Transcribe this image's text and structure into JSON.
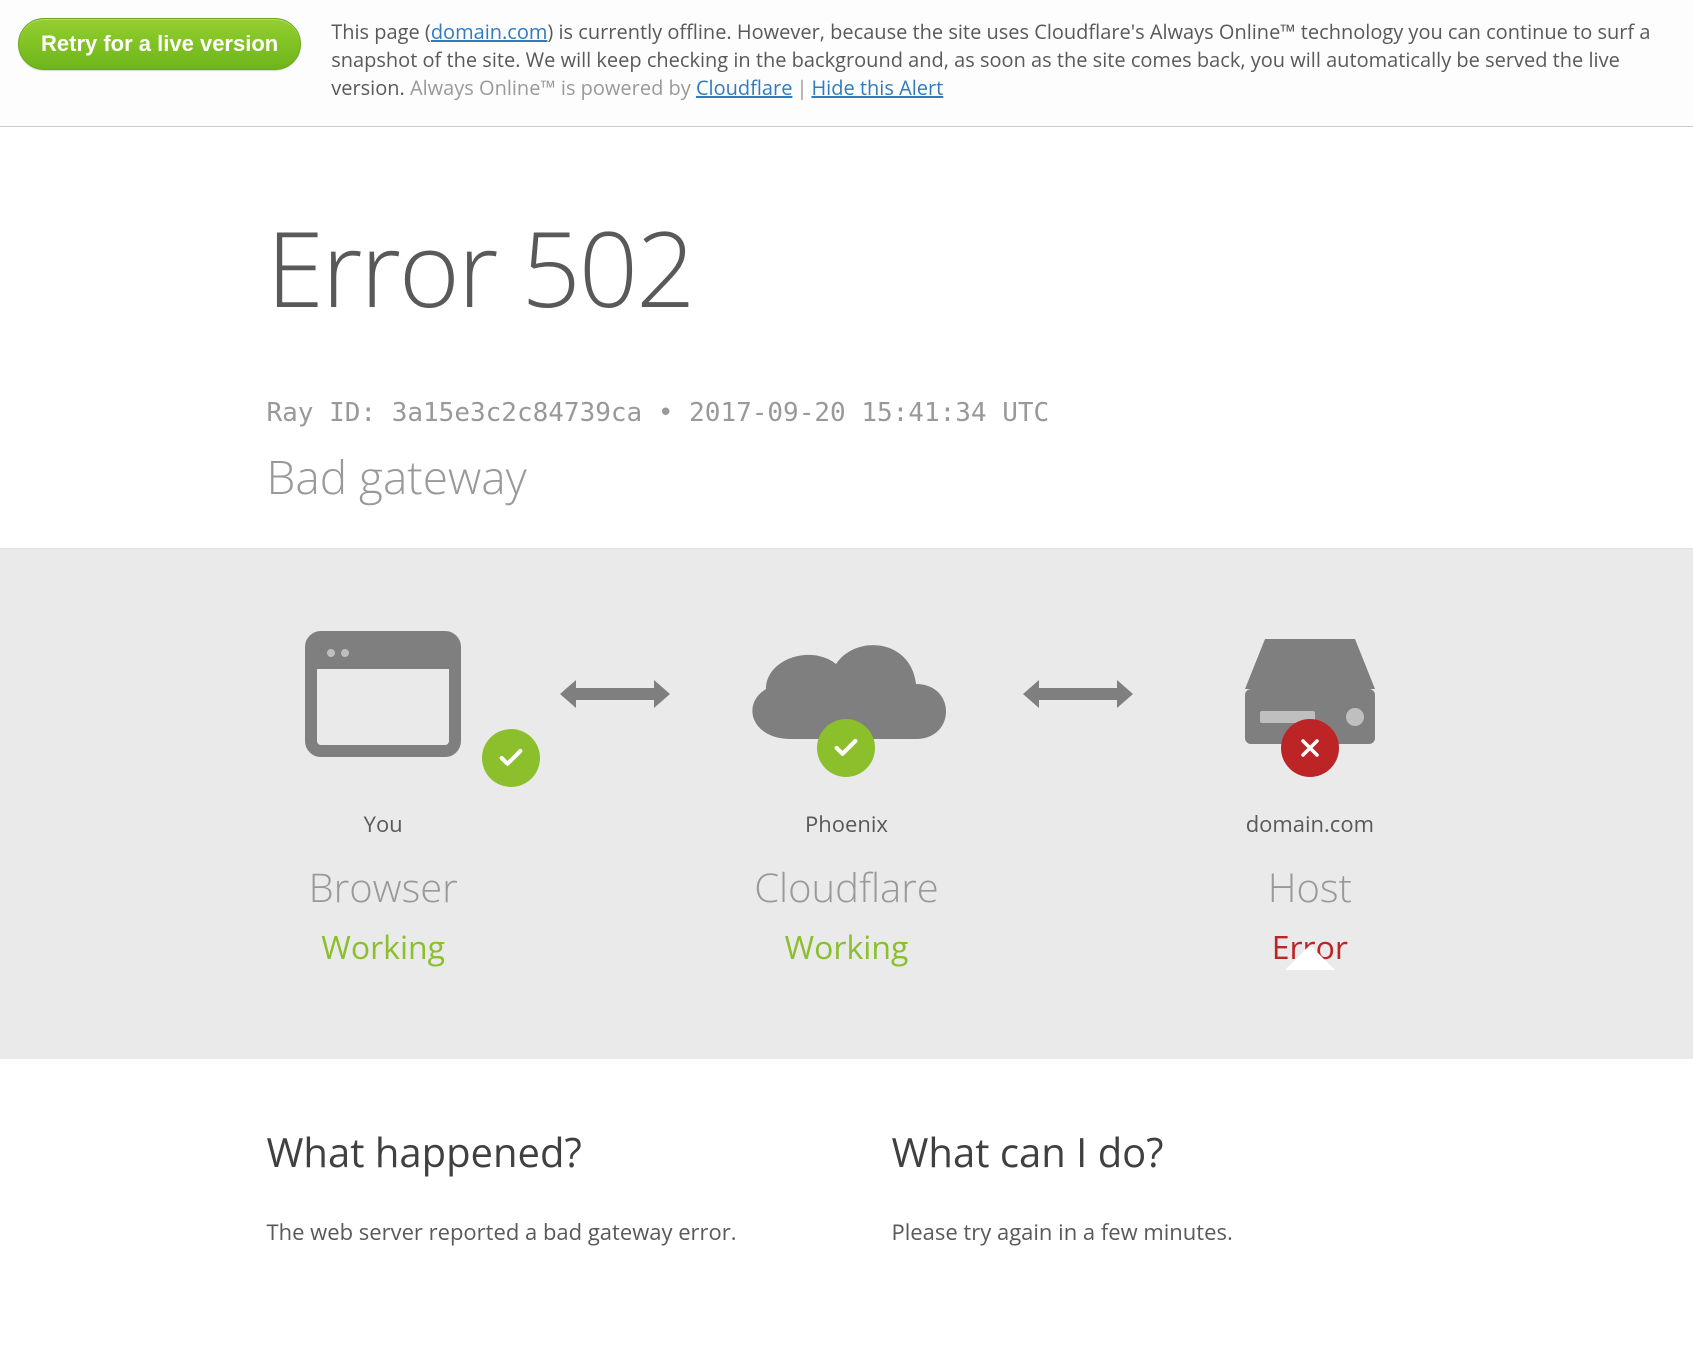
{
  "alert": {
    "retry_button": "Retry for a live version",
    "text1": "This page (",
    "domain_link": "domain.com",
    "text2": ") is currently offline. However, because the site uses Cloudflare's Always Online™ technology you can continue to surf a snapshot of the site. We will keep checking in the background and, as soon as the site comes back, you will automatically be served the live version. ",
    "powered_pre": "Always Online™ is powered by ",
    "cloudflare_link": "Cloudflare",
    "hide_link": "Hide this Alert"
  },
  "error": {
    "title": "Error 502",
    "ray": "Ray ID: 3a15e3c2c84739ca • 2017-09-20 15:41:34 UTC",
    "subtitle": "Bad gateway"
  },
  "nodes": {
    "you": {
      "label": "You",
      "title": "Browser",
      "status": "Working"
    },
    "cf": {
      "label": "Phoenix",
      "title": "Cloudflare",
      "status": "Working"
    },
    "host": {
      "label": "domain.com",
      "title": "Host",
      "status": "Error"
    }
  },
  "explain": {
    "left_h": "What happened?",
    "left_p": "The web server reported a bad gateway error.",
    "right_h": "What can I do?",
    "right_p": "Please try again in a few minutes."
  }
}
